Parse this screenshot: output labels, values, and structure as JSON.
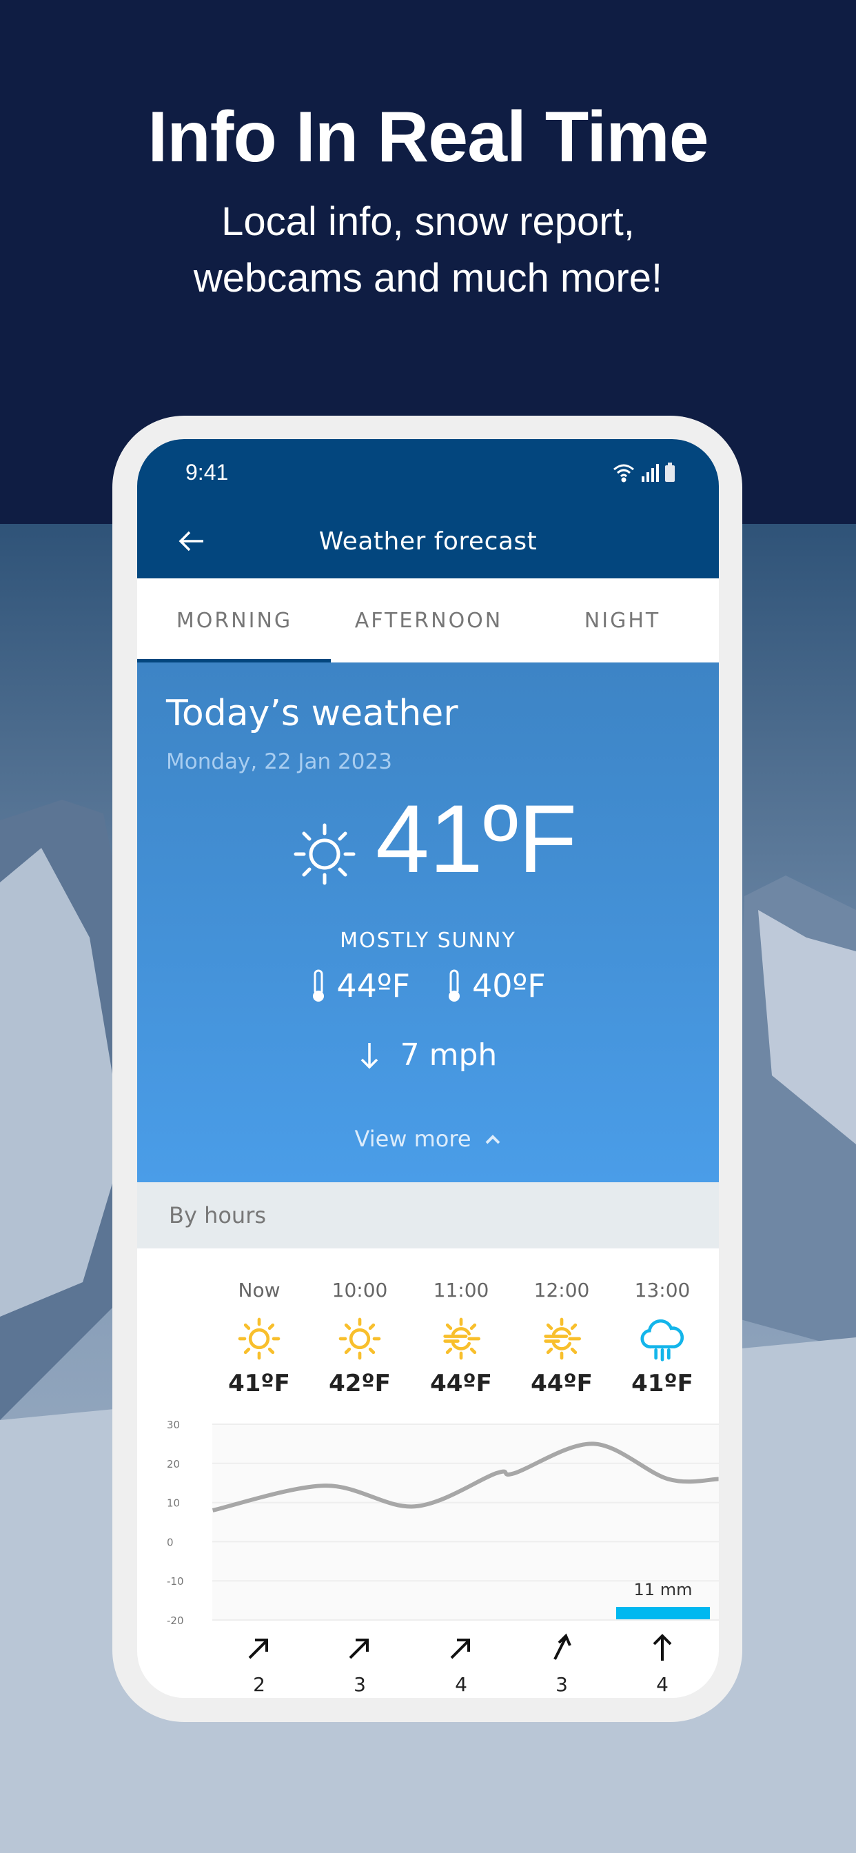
{
  "promo": {
    "headline": "Info In Real Time",
    "subtitle_line1": "Local info, snow report,",
    "subtitle_line2": "webcams and much more!"
  },
  "status_bar": {
    "time": "9:41",
    "icons": [
      "wifi-icon",
      "signal-icon",
      "battery-icon"
    ]
  },
  "app_bar": {
    "title": "Weather forecast",
    "back_icon": "arrow-left-icon"
  },
  "tabs": [
    {
      "label": "MORNING",
      "active": true
    },
    {
      "label": "AFTERNOON",
      "active": false
    },
    {
      "label": "NIGHT",
      "active": false
    }
  ],
  "today": {
    "title": "Today’s weather",
    "date": "Monday, 22 Jan 2023",
    "icon": "sun-icon",
    "temperature": "41ºF",
    "condition": "MOSTLY SUNNY",
    "high": "44ºF",
    "low": "40ºF",
    "wind": "7 mph",
    "wind_icon": "arrow-down-icon",
    "view_more": "View more"
  },
  "by_hours": {
    "label": "By hours",
    "hours": [
      {
        "time": "Now",
        "icon": "sun",
        "temp": "41ºF",
        "wind_dir": "ne",
        "wind": "2"
      },
      {
        "time": "10:00",
        "icon": "sun",
        "temp": "42ºF",
        "wind_dir": "ne",
        "wind": "3"
      },
      {
        "time": "11:00",
        "icon": "sun-haze",
        "temp": "44ºF",
        "wind_dir": "ne",
        "wind": "4"
      },
      {
        "time": "12:00",
        "icon": "sun-haze",
        "temp": "44ºF",
        "wind_dir": "nne",
        "wind": "3"
      },
      {
        "time": "13:00",
        "icon": "cloud-rain",
        "temp": "41ºF",
        "wind_dir": "n",
        "wind": "4"
      }
    ]
  },
  "colors": {
    "navy": "#0f1d43",
    "app_bar": "#03467e",
    "sun": "#f8bf2c",
    "rain": "#13b5ea",
    "precip_bar": "#00b8f0",
    "line": "#a7a7a7"
  },
  "chart_data": {
    "type": "line",
    "yticks": [
      "30",
      "20",
      "10",
      "0",
      "-10",
      "-20"
    ],
    "ylim": [
      -20,
      30
    ],
    "xlim": [
      -0.46,
      4.55
    ],
    "series": [
      {
        "points": [
          [
            -0.46,
            8
          ],
          [
            0.65,
            14.3
          ],
          [
            1.54,
            9
          ],
          [
            2.35,
            17.5
          ],
          [
            2.53,
            17.5
          ],
          [
            3.31,
            25
          ],
          [
            4.05,
            16
          ],
          [
            4.55,
            16
          ]
        ]
      }
    ],
    "precipitation": {
      "column": 4,
      "label": "11 mm",
      "value": 11
    },
    "grid": true
  }
}
